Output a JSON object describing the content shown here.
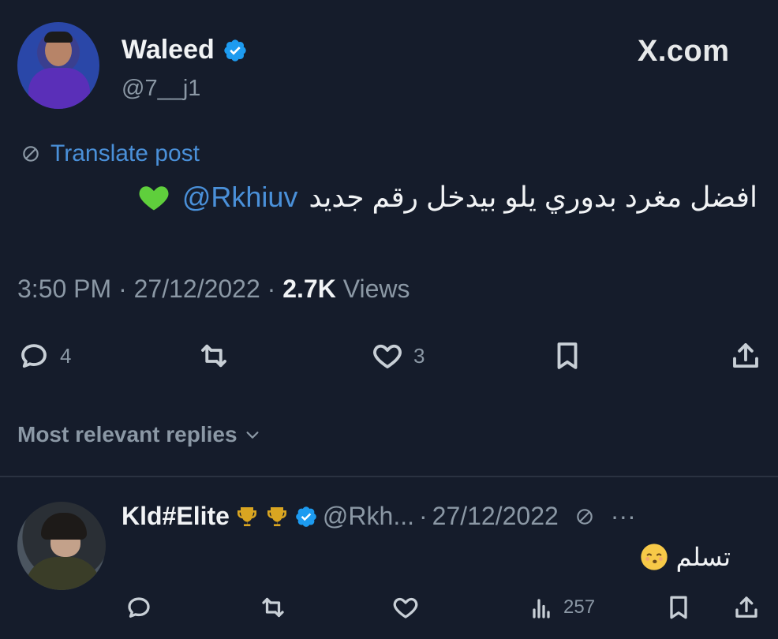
{
  "header": {
    "name": "Waleed",
    "handle": "@7__j1",
    "brand": "X.com"
  },
  "post": {
    "translate_label": "Translate post",
    "text": "افضل مغرد بدوري يلو بيدخل رقم جديد",
    "mention": "@Rkhiuv",
    "emoji": "green-heart",
    "time": "3:50 PM",
    "date": "27/12/2022",
    "views_count": "2.7K",
    "views_label": "Views",
    "sep": "·"
  },
  "actions": {
    "replies": "4",
    "reposts": "",
    "likes": "3"
  },
  "replies_sort": {
    "label": "Most relevant replies"
  },
  "reply": {
    "name": "Kld#Elite",
    "handle": "@Rkh...",
    "sep": "·",
    "date": "27/12/2022",
    "more": "···",
    "text": "تسلم",
    "views": "257"
  },
  "colors": {
    "background": "#151c2b",
    "accent": "#4a90d9",
    "muted": "#8b98a5",
    "verified": "#1d9bf0"
  }
}
